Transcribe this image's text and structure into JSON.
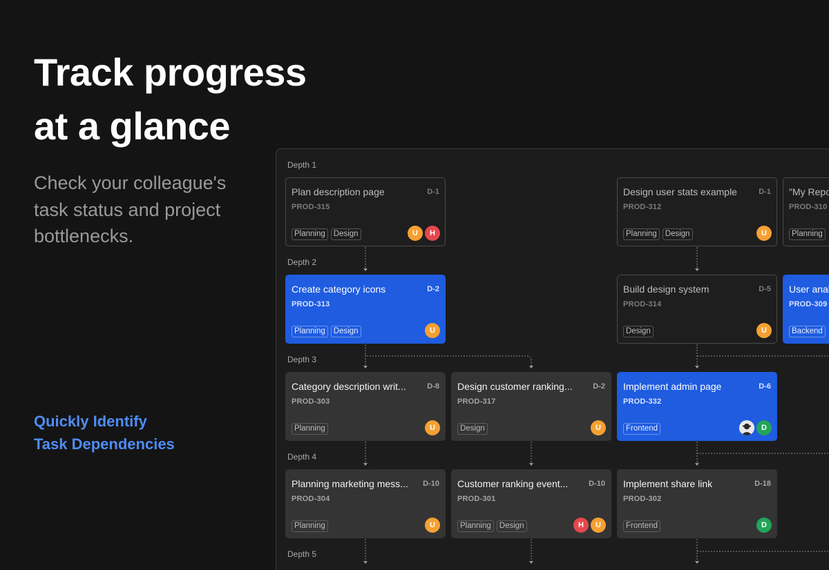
{
  "hero": {
    "title_lines": [
      "Track progress",
      "at a glance"
    ],
    "subtitle_lines": [
      "Check your colleague's",
      "task status and project",
      "bottlenecks."
    ],
    "callout_lines": [
      "Quickly Identify",
      "Task Dependencies"
    ]
  },
  "colors": {
    "accent_blue": "#1f5ce0",
    "callout_blue": "#4f8cf7",
    "orange": "#f5a032",
    "red": "#e5484d",
    "green": "#22a559"
  },
  "board": {
    "depths": [
      "Depth 1",
      "Depth 2",
      "Depth 3",
      "Depth 4",
      "Depth 5"
    ],
    "cards": [
      {
        "title": "Plan description page",
        "due": "D-1",
        "id": "PROD-315",
        "tags": [
          "Planning",
          "Design"
        ],
        "style": "muted",
        "avatars": [
          "U",
          "H"
        ]
      },
      {
        "title": "Design user stats example",
        "due": "D-1",
        "id": "PROD-312",
        "tags": [
          "Planning",
          "Design"
        ],
        "style": "muted",
        "avatars": [
          "U"
        ]
      },
      {
        "title": "\"My Repo",
        "due": "",
        "id": "PROD-310",
        "tags": [
          "Planning"
        ],
        "style": "muted",
        "avatars": []
      },
      {
        "title": "Create category icons",
        "due": "D-2",
        "id": "PROD-313",
        "tags": [
          "Planning",
          "Design"
        ],
        "style": "blue",
        "avatars": [
          "U"
        ]
      },
      {
        "title": "Build design system",
        "due": "D-5",
        "id": "PROD-314",
        "tags": [
          "Design"
        ],
        "style": "muted",
        "avatars": [
          "U"
        ]
      },
      {
        "title": "User anal",
        "due": "",
        "id": "PROD-309",
        "tags": [
          "Backend"
        ],
        "style": "blue",
        "avatars": []
      },
      {
        "title": "Category description writ...",
        "due": "D-8",
        "id": "PROD-303",
        "tags": [
          "Planning"
        ],
        "style": "dark",
        "avatars": [
          "U"
        ]
      },
      {
        "title": "Design customer ranking...",
        "due": "D-2",
        "id": "PROD-317",
        "tags": [
          "Design"
        ],
        "style": "dark",
        "avatars": [
          "U"
        ]
      },
      {
        "title": "Implement admin page",
        "due": "D-6",
        "id": "PROD-332",
        "tags": [
          "Frontend"
        ],
        "style": "blue",
        "avatars": [
          "photo",
          "D"
        ]
      },
      {
        "title": "Planning marketing mess...",
        "due": "D-10",
        "id": "PROD-304",
        "tags": [
          "Planning"
        ],
        "style": "dark",
        "avatars": [
          "U"
        ]
      },
      {
        "title": "Customer ranking event...",
        "due": "D-10",
        "id": "PROD-301",
        "tags": [
          "Planning",
          "Design"
        ],
        "style": "dark",
        "avatars": [
          "H",
          "U"
        ]
      },
      {
        "title": "Implement share link",
        "due": "D-18",
        "id": "PROD-302",
        "tags": [
          "Frontend"
        ],
        "style": "dark",
        "avatars": [
          "D"
        ]
      }
    ]
  }
}
